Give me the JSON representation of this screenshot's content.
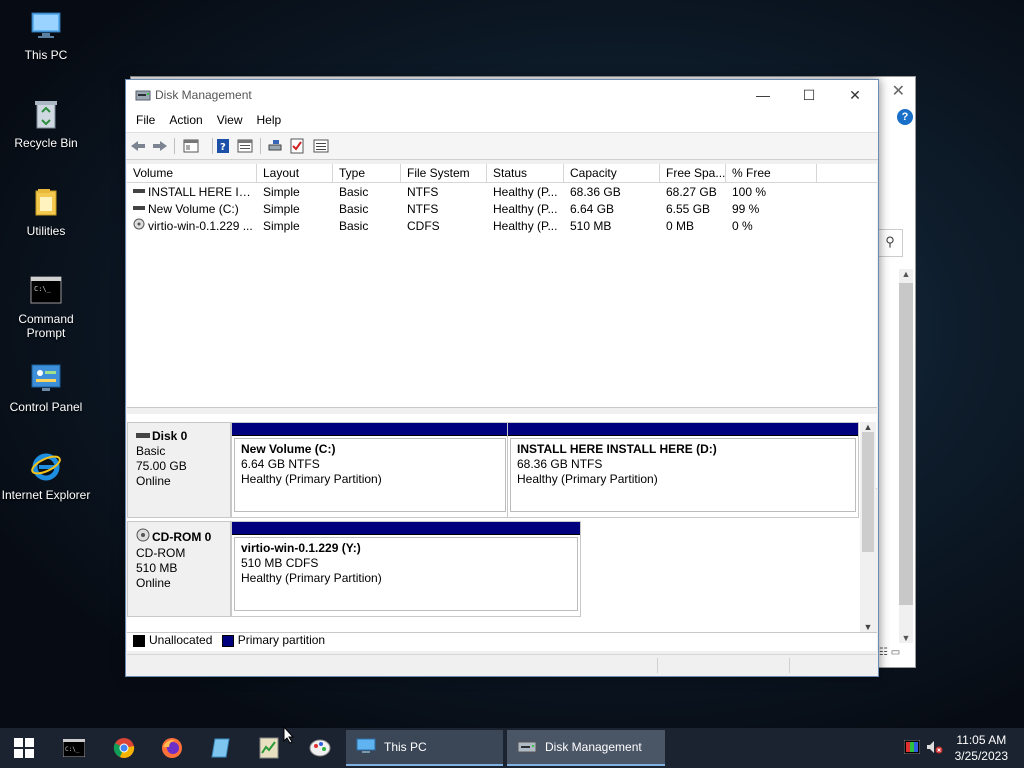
{
  "desktop": {
    "icons": [
      {
        "label": "This PC"
      },
      {
        "label": "Recycle Bin"
      },
      {
        "label": "Utilities"
      },
      {
        "label": "Command Prompt"
      },
      {
        "label": "Control Panel"
      },
      {
        "label": "Internet Explorer"
      }
    ]
  },
  "window": {
    "title": "Disk Management",
    "menu": [
      "File",
      "Action",
      "View",
      "Help"
    ],
    "volume_list": {
      "columns": [
        "Volume",
        "Layout",
        "Type",
        "File System",
        "Status",
        "Capacity",
        "Free Spa...",
        "% Free"
      ],
      "rows": [
        [
          "INSTALL HERE INS...",
          "Simple",
          "Basic",
          "NTFS",
          "Healthy (P...",
          "68.36 GB",
          "68.27 GB",
          "100 %"
        ],
        [
          "New Volume (C:)",
          "Simple",
          "Basic",
          "NTFS",
          "Healthy (P...",
          "6.64 GB",
          "6.55 GB",
          "99 %"
        ],
        [
          "virtio-win-0.1.229 ...",
          "Simple",
          "Basic",
          "CDFS",
          "Healthy (P...",
          "510 MB",
          "0 MB",
          "0 %"
        ]
      ]
    },
    "disks": [
      {
        "name": "Disk 0",
        "kind": "Basic",
        "size": "75.00 GB",
        "state": "Online",
        "partitions": [
          {
            "name": "New Volume  (C:)",
            "size": "6.64 GB NTFS",
            "status": "Healthy (Primary Partition)"
          },
          {
            "name": "INSTALL HERE INSTALL HERE  (D:)",
            "size": "68.36 GB NTFS",
            "status": "Healthy (Primary Partition)"
          }
        ]
      },
      {
        "name": "CD-ROM 0",
        "kind": "CD-ROM",
        "size": "510 MB",
        "state": "Online",
        "partitions": [
          {
            "name": "virtio-win-0.1.229  (Y:)",
            "size": "510 MB CDFS",
            "status": "Healthy (Primary Partition)"
          }
        ]
      }
    ],
    "legend": [
      {
        "label": "Unallocated",
        "color": "#000000"
      },
      {
        "label": "Primary partition",
        "color": "#00007f"
      }
    ]
  },
  "taskbar": {
    "tasks": [
      {
        "label": "This PC"
      },
      {
        "label": "Disk Management"
      }
    ],
    "clock": {
      "time": "11:05 AM",
      "date": "3/25/2023"
    }
  }
}
